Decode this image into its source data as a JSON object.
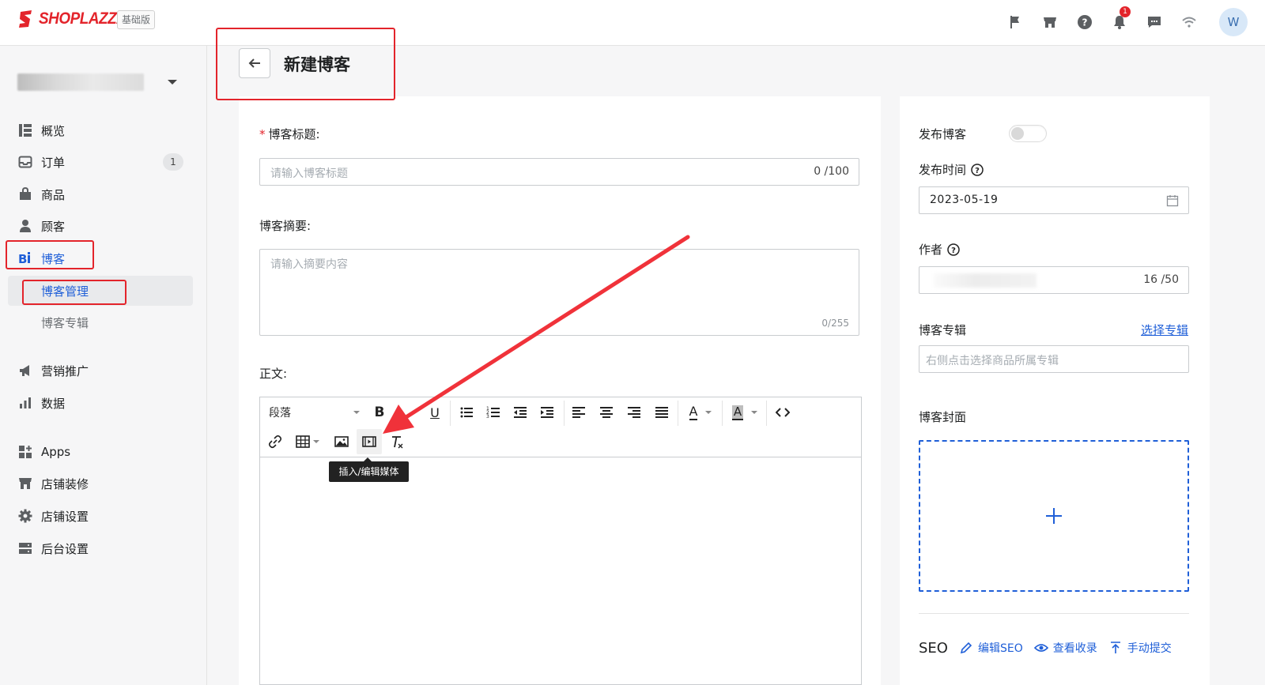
{
  "brand": {
    "name": "SHOPLAZZA",
    "plan": "基础版",
    "accent": "#e3242b",
    "link_color": "#1f5fd8"
  },
  "topbar": {
    "icons": [
      "flag-icon",
      "store-icon",
      "help-icon",
      "bell-icon",
      "chat-icon",
      "wifi-icon"
    ],
    "notification_count": "1",
    "avatar_initial": "W"
  },
  "sidebar": {
    "items": [
      {
        "label": "概览",
        "icon": "dashboard-icon"
      },
      {
        "label": "订单",
        "icon": "inbox-icon",
        "count": "1"
      },
      {
        "label": "商品",
        "icon": "bag-icon"
      },
      {
        "label": "顾客",
        "icon": "person-icon"
      },
      {
        "label": "博客",
        "icon": "blog-icon"
      },
      {
        "label": "营销推广",
        "icon": "megaphone-icon"
      },
      {
        "label": "数据",
        "icon": "bar-chart-icon"
      },
      {
        "label": "Apps",
        "icon": "apps-icon"
      },
      {
        "label": "店铺装修",
        "icon": "storefront-icon"
      },
      {
        "label": "店铺设置",
        "icon": "gear-icon"
      },
      {
        "label": "后台设置",
        "icon": "server-icon"
      }
    ],
    "blog_subitems": [
      {
        "label": "博客管理"
      },
      {
        "label": "博客专辑"
      }
    ]
  },
  "header": {
    "title": "新建博客"
  },
  "form": {
    "title_label": "博客标题:",
    "title_required_mark": "*",
    "title_placeholder": "请输入博客标题",
    "title_counter": "0 /100",
    "summary_label": "博客摘要:",
    "summary_placeholder": "请输入摘要内容",
    "summary_counter": "0/255",
    "body_label": "正文:"
  },
  "editor": {
    "paragraph_select": "段落",
    "bold_label": "B",
    "underline_label": "U",
    "text_color_label": "A",
    "bg_color_label": "A",
    "tooltip": "插入/编辑媒体"
  },
  "side": {
    "publish_label": "发布博客",
    "publish_enabled": false,
    "publish_time_label": "发布时间",
    "publish_date": "2023-05-19",
    "author_label": "作者",
    "author_counter": "16 /50",
    "album_label": "博客专辑",
    "album_link": "选择专辑",
    "album_placeholder": "右侧点击选择商品所属专辑",
    "cover_label": "博客封面",
    "seo_title": "SEO",
    "seo_edit": "编辑SEO",
    "seo_view": "查看收录",
    "seo_submit": "手动提交"
  }
}
